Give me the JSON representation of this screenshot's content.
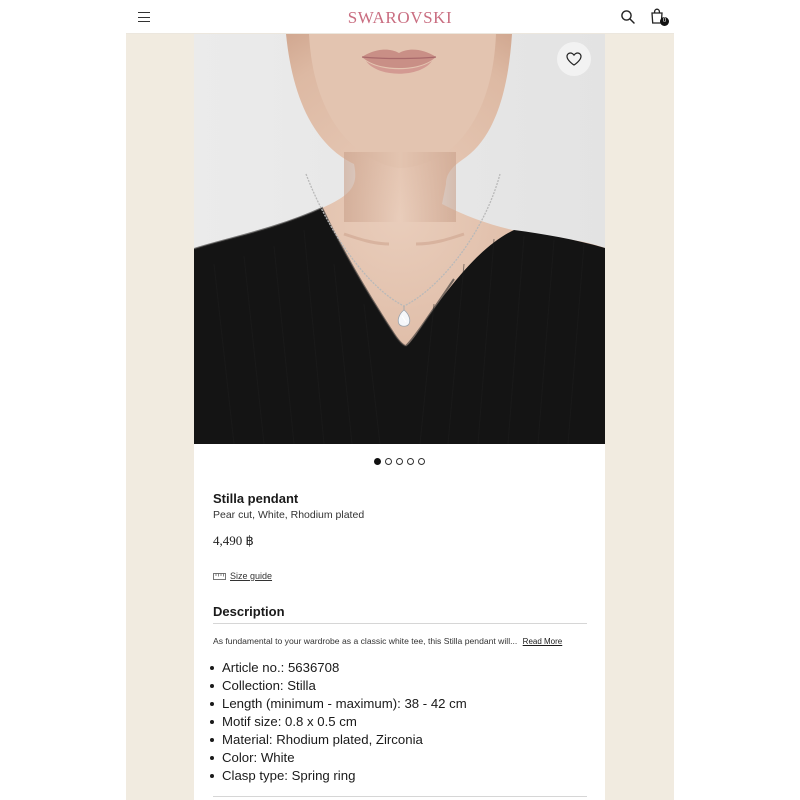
{
  "header": {
    "logo": "SWAROVSKI",
    "bag_count": "0",
    "icons": {
      "menu": "hamburger-menu-icon",
      "search": "search-icon",
      "bag": "shopping-bag-icon"
    }
  },
  "gallery": {
    "image": "model-wearing-pendant-photo",
    "wishlist_icon": "heart-icon",
    "dots_total": 5,
    "active_dot": 1
  },
  "product": {
    "name": "Stilla pendant",
    "variant": "Pear cut, White, Rhodium plated",
    "price": "4,490 ฿",
    "size_guide_label": "Size guide",
    "size_guide_icon": "ruler-icon"
  },
  "description": {
    "heading": "Description",
    "text": "As fundamental to your wardrobe as a classic white tee, this Stilla pendant will...",
    "read_more": "Read More",
    "specs": [
      "Article no.: 5636708",
      "Collection:  Stilla",
      "Length (minimum - maximum): 38 - 42 cm",
      "Motif size: 0.8 x 0.5 cm",
      "Material:  Rhodium plated, Zirconia",
      "Color:  White",
      "Clasp type:  Spring ring"
    ]
  },
  "colors": {
    "brand": "#c96d80",
    "background": "#f1ebe0",
    "text": "#1a1a1a"
  }
}
